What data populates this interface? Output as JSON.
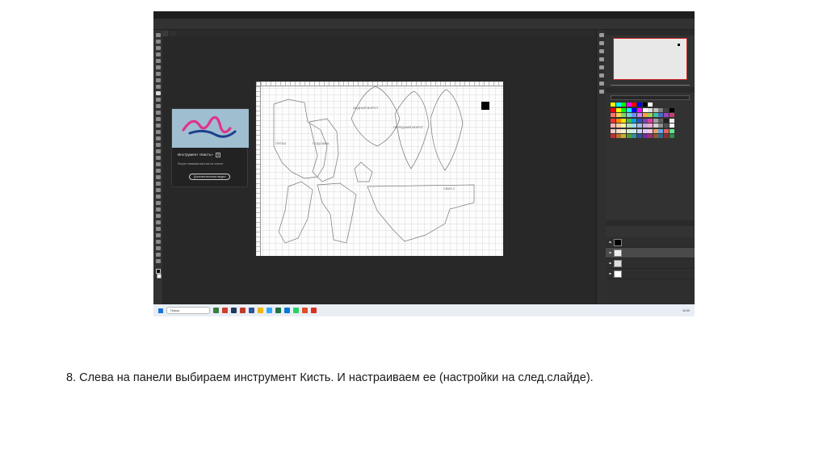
{
  "caption": "8. Слева на панели выбираем инструмент Кисть. И настраиваем ее (настройки на след.слайде).",
  "tooltip": {
    "title": "Инструмент «Кисть»",
    "shortcut": "B",
    "description": "Рисует мазками кистью на холсте",
    "button_label": "Дополнительные видео"
  },
  "document_labels": [
    "ПЯТКА",
    "ПОДОШВА",
    "ЗАДНИЙ ВОРОТ",
    "ПЕРЕДНИЙ ВОРОТ",
    "СВИЗ 2"
  ],
  "colors": {
    "accent_pink": "#e0338c",
    "accent_blue": "#1f3f8f",
    "photoshop_bg": "#2b2b2b",
    "taskbar_bg": "#e9eef5"
  },
  "taskbar": {
    "search_placeholder": "Поиск",
    "time": "10:09"
  }
}
